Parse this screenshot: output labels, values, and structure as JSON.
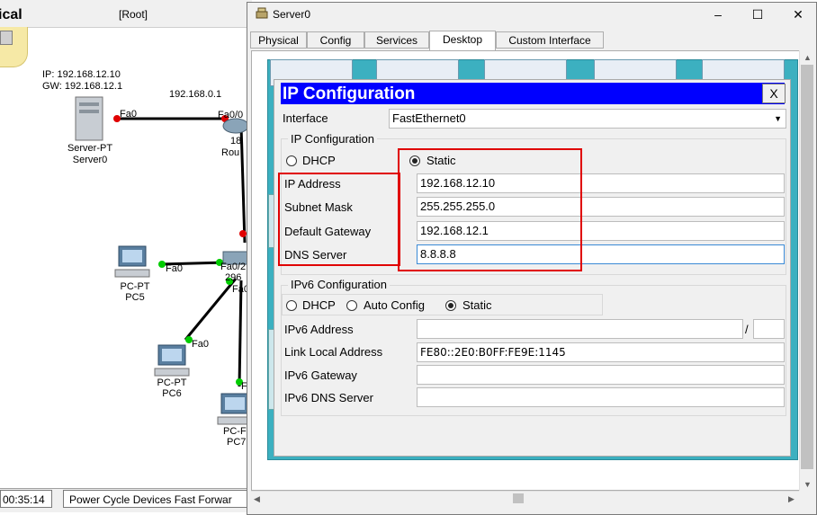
{
  "background": {
    "mode_title": "ical",
    "root_label": "[Root]",
    "server_ip_text": "IP: 192.168.12.10",
    "server_gw_text": "GW: 192.168.12.1",
    "router_ip_text": "192.168.0.1",
    "server_device_type": "Server-PT",
    "server_device_name": "Server0",
    "router_port": "Fa0/0",
    "router_partial_label_1": "18",
    "router_partial_label_2": "Rou",
    "server_port": "Fa0",
    "pc5_port": "Fa0",
    "switch_port_1": "Fa0/2",
    "switch_partial_label": "296",
    "switch_port_2": "Fa0",
    "pc6_port": "Fa0",
    "pc7_port": "F",
    "pc5_type": "PC-PT",
    "pc5_name": "PC5",
    "pc6_type": "PC-PT",
    "pc6_name": "PC6",
    "pc7_type": "PC-F",
    "pc7_name": "PC7",
    "status_time": "00:35:14",
    "status_actions": "Power Cycle Devices  Fast Forwar"
  },
  "window": {
    "title": "Server0",
    "buttons": {
      "minimize": "–",
      "maximize": "☐",
      "close": "✕"
    },
    "tabs": [
      "Physical",
      "Config",
      "Services",
      "Desktop",
      "Custom Interface"
    ],
    "active_tab": "Desktop"
  },
  "ip_config": {
    "title": "IP Configuration",
    "close": "X",
    "interface_label": "Interface",
    "interface_value": "FastEthernet0",
    "ipv4_group_label": "IP Configuration",
    "dhcp_label": "DHCP",
    "static_label": "Static",
    "mode": "Static",
    "ip_address_label": "IP Address",
    "ip_address": "192.168.12.10",
    "subnet_mask_label": "Subnet Mask",
    "subnet_mask": "255.255.255.0",
    "gateway_label": "Default Gateway",
    "gateway": "192.168.12.1",
    "dns_label": "DNS Server",
    "dns": "8.8.8.8",
    "ipv6_group_label": "IPv6 Configuration",
    "ipv6_dhcp_label": "DHCP",
    "ipv6_auto_label": "Auto Config",
    "ipv6_static_label": "Static",
    "ipv6_mode": "Static",
    "ipv6_address_label": "IPv6 Address",
    "ipv6_address": "",
    "ipv6_prefix_sep": "/",
    "ipv6_prefix": "",
    "link_local_label": "Link Local Address",
    "link_local": "FE80::2E0:B0FF:FE9E:1145",
    "ipv6_gateway_label": "IPv6 Gateway",
    "ipv6_gateway": "",
    "ipv6_dns_label": "IPv6 DNS Server",
    "ipv6_dns": ""
  },
  "colors": {
    "title_bar": "#0000ff",
    "highlight_box": "#e00000",
    "desktop_bg": "#3cb0c0",
    "link_green": "#00cc00",
    "link_red": "#e00000"
  }
}
